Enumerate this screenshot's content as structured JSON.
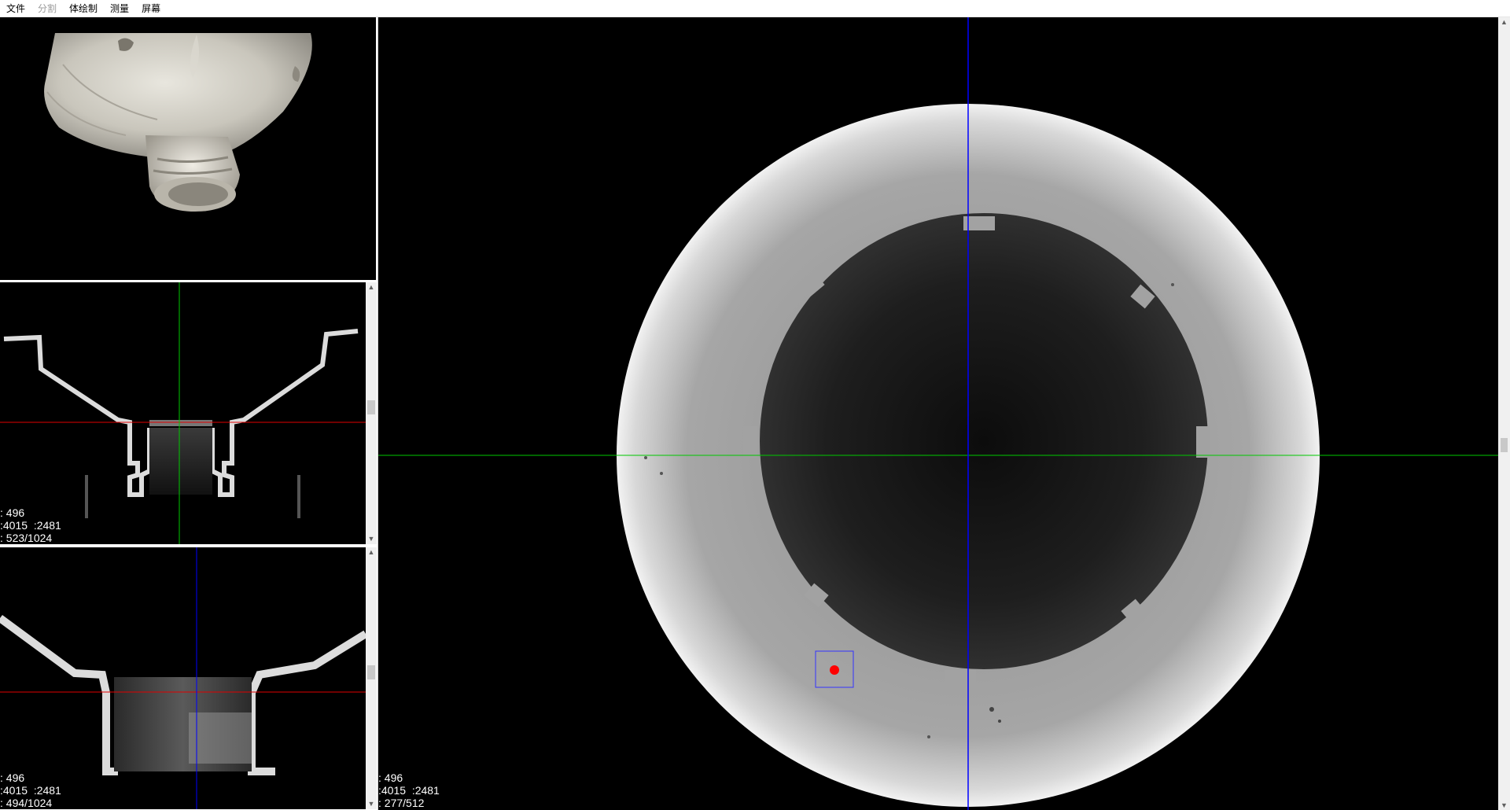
{
  "menubar": {
    "items": [
      {
        "label": "文件",
        "enabled": true
      },
      {
        "label": "分割",
        "enabled": false
      },
      {
        "label": "体绘制",
        "enabled": true
      },
      {
        "label": "测量",
        "enabled": true
      },
      {
        "label": "屏幕",
        "enabled": true
      }
    ]
  },
  "sagittal_view": {
    "info_line1": ": 496",
    "info_line2": ":4015  :2481",
    "info_line3": ": 523/1024"
  },
  "coronal_view": {
    "info_line1": ": 496",
    "info_line2": ":4015  :2481",
    "info_line3": ": 494/1024"
  },
  "axial_view": {
    "info_line1": ": 496",
    "info_line2": ":4015  :2481",
    "info_line3": ": 277/512"
  },
  "colors": {
    "crosshair_horizontal_axial": "#00c800",
    "crosshair_vertical_axial": "#0000ff",
    "crosshair_horizontal_slice": "#e00000",
    "crosshair_vertical_sagittal": "#00c800",
    "crosshair_vertical_coronal": "#0000ff",
    "marker": "#ff0000",
    "marker_box": "#3333ff"
  },
  "scrollbar_icons": {
    "up": "▲",
    "down": "▼"
  }
}
